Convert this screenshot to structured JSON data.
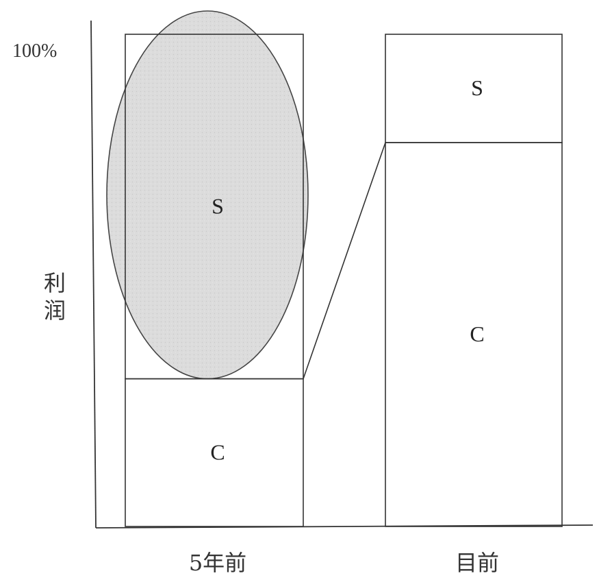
{
  "chart_data": {
    "type": "bar",
    "stacked": true,
    "ylabel": "利\n润",
    "yticks": [
      "100%"
    ],
    "ylim": [
      0,
      100
    ],
    "categories": [
      "5年前",
      "目前"
    ],
    "series": [
      {
        "name": "C",
        "values": [
          30,
          78
        ]
      },
      {
        "name": "S",
        "values": [
          70,
          22
        ]
      }
    ],
    "highlight": {
      "category": "5年前",
      "series": "S",
      "shape": "ellipse",
      "color": "#d9d9d9"
    },
    "connector": {
      "from": "5年前",
      "to": "目前",
      "at_series_boundary": "C/S"
    },
    "grid": false,
    "legend": "none"
  }
}
